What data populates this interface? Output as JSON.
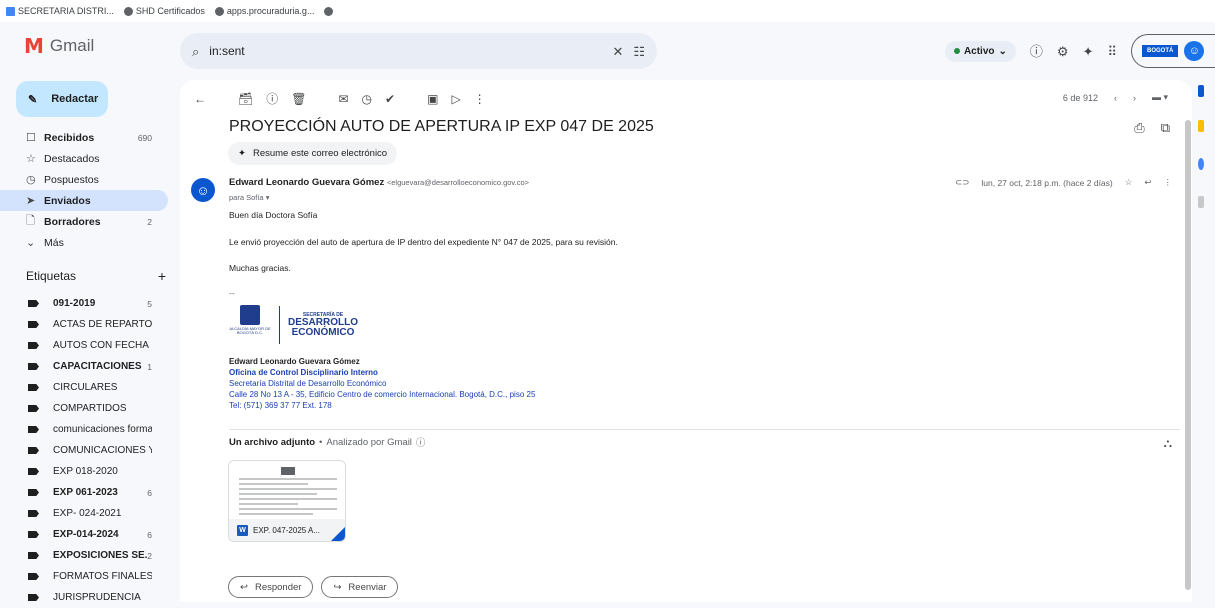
{
  "bookmarks": [
    {
      "label": "SECRETARIA DISTRI..."
    },
    {
      "label": "SHD Certificados"
    },
    {
      "label": "apps.procuraduria.g..."
    }
  ],
  "app": {
    "name": "Gmail"
  },
  "search": {
    "query": "in:sent"
  },
  "status": {
    "label": "Activo"
  },
  "account": {
    "badge": "BOGOTÁ"
  },
  "compose": {
    "label": "Redactar"
  },
  "nav": [
    {
      "label": "Recibidos",
      "count": "690",
      "icon": "inbox-icon",
      "glyph": "☐",
      "bold": true
    },
    {
      "label": "Destacados",
      "count": "",
      "icon": "star-icon",
      "glyph": "☆",
      "bold": false
    },
    {
      "label": "Pospuestos",
      "count": "",
      "icon": "clock-icon",
      "glyph": "◷",
      "bold": false
    },
    {
      "label": "Enviados",
      "count": "",
      "icon": "send-icon",
      "glyph": "➤",
      "bold": true,
      "active": true
    },
    {
      "label": "Borradores",
      "count": "2",
      "icon": "draft-icon",
      "glyph": "🗋",
      "bold": true
    },
    {
      "label": "Más",
      "count": "",
      "icon": "chevron-down-icon",
      "glyph": "⌄",
      "bold": false
    }
  ],
  "labels_header": "Etiquetas",
  "labels": [
    {
      "label": "091-2019",
      "count": "5",
      "bold": true
    },
    {
      "label": "ACTAS DE REPARTO",
      "count": "",
      "bold": false
    },
    {
      "label": "AUTOS CON FECHA",
      "count": "",
      "bold": false
    },
    {
      "label": "CAPACITACIONES",
      "count": "1",
      "bold": true
    },
    {
      "label": "CIRCULARES",
      "count": "",
      "bold": false
    },
    {
      "label": "COMPARTIDOS",
      "count": "",
      "bold": false
    },
    {
      "label": "comunicaciones formato...",
      "count": "",
      "bold": false
    },
    {
      "label": "COMUNICACIONES Y/O ...",
      "count": "",
      "bold": false
    },
    {
      "label": "EXP 018-2020",
      "count": "",
      "bold": false
    },
    {
      "label": "EXP 061-2023",
      "count": "6",
      "bold": true
    },
    {
      "label": "EXP- 024-2021",
      "count": "",
      "bold": false
    },
    {
      "label": "EXP-014-2024",
      "count": "6",
      "bold": true
    },
    {
      "label": "EXPOSICIONES SE...",
      "count": "2",
      "bold": true
    },
    {
      "label": "FORMATOS FINALES PR...",
      "count": "",
      "bold": false
    },
    {
      "label": "JURISPRUDENCIA",
      "count": "",
      "bold": false
    }
  ],
  "pager": {
    "text": "6 de 912"
  },
  "email": {
    "subject": "PROYECCIÓN AUTO DE APERTURA IP EXP 047 DE 2025",
    "summarize": "Resume este correo electrónico",
    "sender_name": "Edward Leonardo Guevara Gómez",
    "sender_email": "<elguevara@desarrolloeconomico.gov.co>",
    "to": "para Sofía ▾",
    "date": "lun, 27 oct, 2:18 p.m. (hace 2 días)",
    "greeting": "Buen día Doctora Sofía",
    "body": "Le envió proyección del auto de apertura de IP dentro del expediente N° 047 de 2025, para su revisión.",
    "thanks": "Muchas gracias.",
    "dash": "--",
    "logo_left": "ALCALDÍA MAYOR DE BOGOTÁ D.C.",
    "logo_top": "SECRETARÍA DE",
    "logo_mid": "DESARROLLO",
    "logo_bot": "ECONÓMICO",
    "sig_name": "Edward Leonardo Guevara Gómez",
    "sig_office": "Oficina de Control Disciplinario Interno",
    "sig_org": "Secretaría Distrital de Desarrollo Económico",
    "sig_addr": "Calle 28 No 13 A - 35, Edificio Centro de comercio Internacional. Bogotá, D.C., piso 25",
    "sig_tel": "Tel: (571) 369 37 77 Ext. 178"
  },
  "attachment": {
    "header": "Un archivo adjunto",
    "sep": "•",
    "scanned": "Analizado por Gmail",
    "filename": "EXP. 047-2025 A..."
  },
  "buttons": {
    "reply": "Responder",
    "forward": "Reenviar"
  },
  "colors": {
    "accent": "#0b57d0",
    "active": "#d3e3fd",
    "compose": "#c2e7ff"
  }
}
